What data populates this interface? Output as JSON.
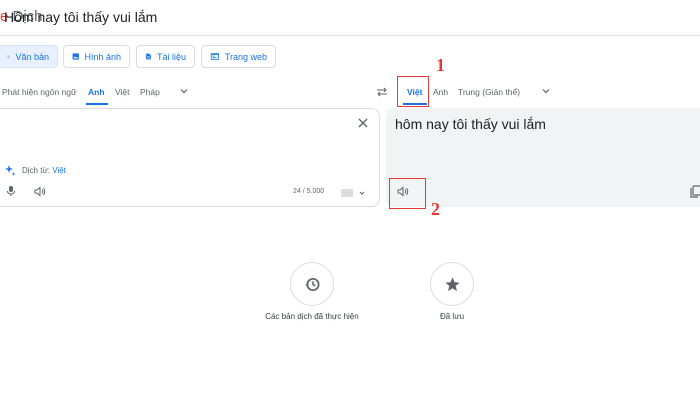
{
  "header": {
    "title_prefix": "e",
    "title": " Dịch"
  },
  "mode_tabs": [
    {
      "label": "Văn bản",
      "icon": "translate-icon",
      "active": true
    },
    {
      "label": "Hình ảnh",
      "icon": "image-icon",
      "active": false
    },
    {
      "label": "Tài liệu",
      "icon": "document-icon",
      "active": false
    },
    {
      "label": "Trang web",
      "icon": "website-icon",
      "active": false
    }
  ],
  "source_languages": {
    "detect": "Phát hiện ngôn ngữ",
    "items": [
      "Anh",
      "Việt",
      "Pháp"
    ],
    "active": "Anh"
  },
  "target_languages": {
    "items": [
      "Việt",
      "Anh",
      "Trung (Giản thể)"
    ],
    "active": "Việt"
  },
  "source": {
    "text": "Hôm nay tôi thấy vui lắm",
    "detected_prefix": "Dịch từ: ",
    "detected_lang": "Việt",
    "char_count": "24 / 5.000"
  },
  "target": {
    "text": "hôm nay tôi thấy vui lắm"
  },
  "annotations": [
    "1",
    "2"
  ],
  "shortcuts": [
    {
      "label": "Các bản dịch đã thực hiện",
      "icon": "history-icon"
    },
    {
      "label": "Đã lưu",
      "icon": "star-icon"
    }
  ],
  "colors": {
    "accent": "#1a73e8",
    "annotation": "#e53935",
    "panel_bg": "#f1f3f4"
  }
}
